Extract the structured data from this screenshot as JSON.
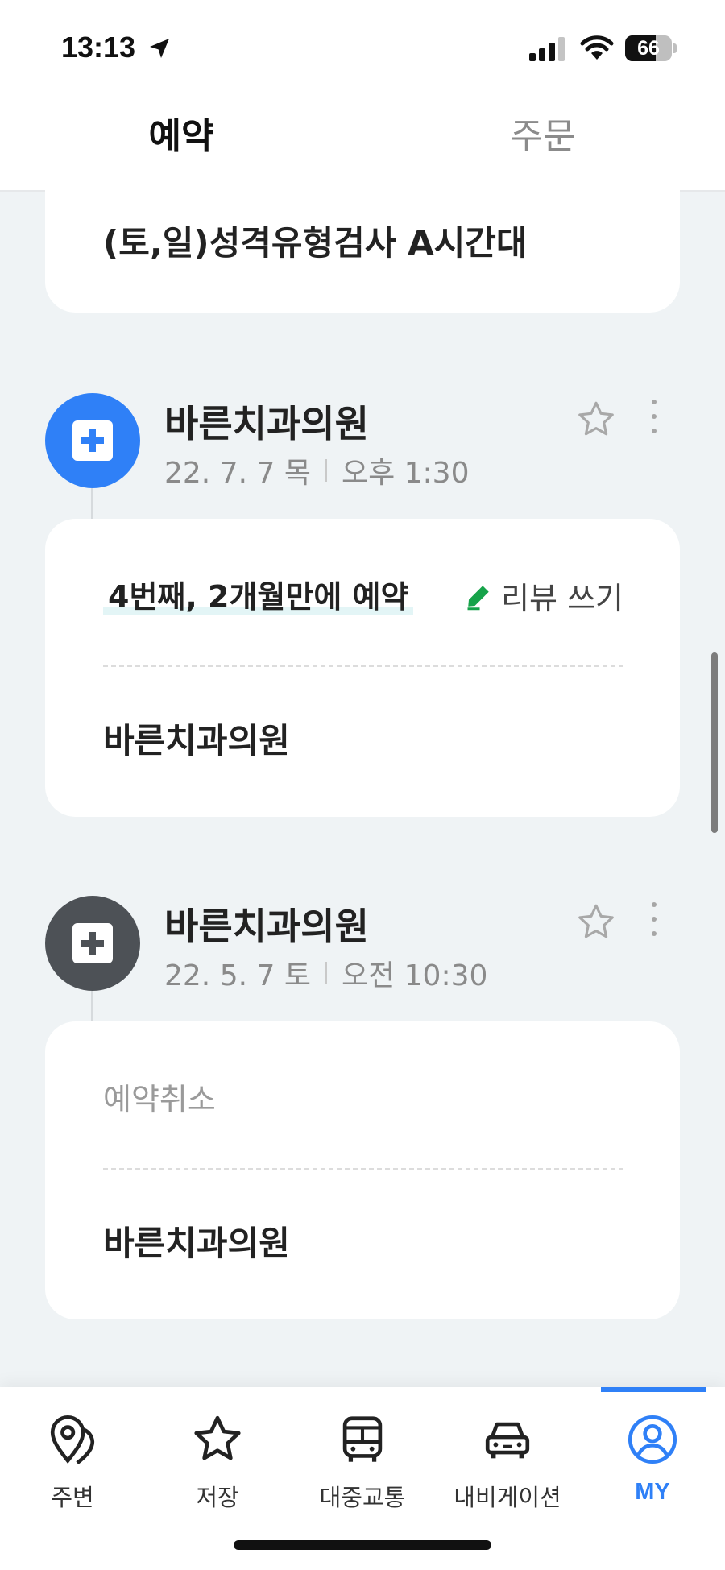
{
  "status_bar": {
    "time": "13:13",
    "battery": "66",
    "battery_level": 0.66
  },
  "tabs": {
    "active": "예약",
    "inactive": "주문"
  },
  "top_card": {
    "title": "(토,일)성격유형검사 A시간대"
  },
  "entries": [
    {
      "title": "바른치과의원",
      "date": "22. 7. 7 목",
      "time": "오후 1:30",
      "icon_color": "#2f80f7",
      "status": "4번째, 2개월만에 예약",
      "review_label": "리뷰 쓰기",
      "place": "바른치과의원"
    },
    {
      "title": "바른치과의원",
      "date": "22. 5. 7 토",
      "time": "오전 10:30",
      "icon_color": "#4d5156",
      "status": "예약취소",
      "place": "바른치과의원"
    }
  ],
  "bottom_nav": {
    "items": [
      {
        "label": "주변",
        "icon": "location-pin-icon"
      },
      {
        "label": "저장",
        "icon": "star-icon"
      },
      {
        "label": "대중교통",
        "icon": "bus-icon"
      },
      {
        "label": "내비게이션",
        "icon": "car-icon"
      },
      {
        "label": "MY",
        "icon": "user-circle-icon"
      }
    ],
    "active_color": "#2f80f7"
  }
}
